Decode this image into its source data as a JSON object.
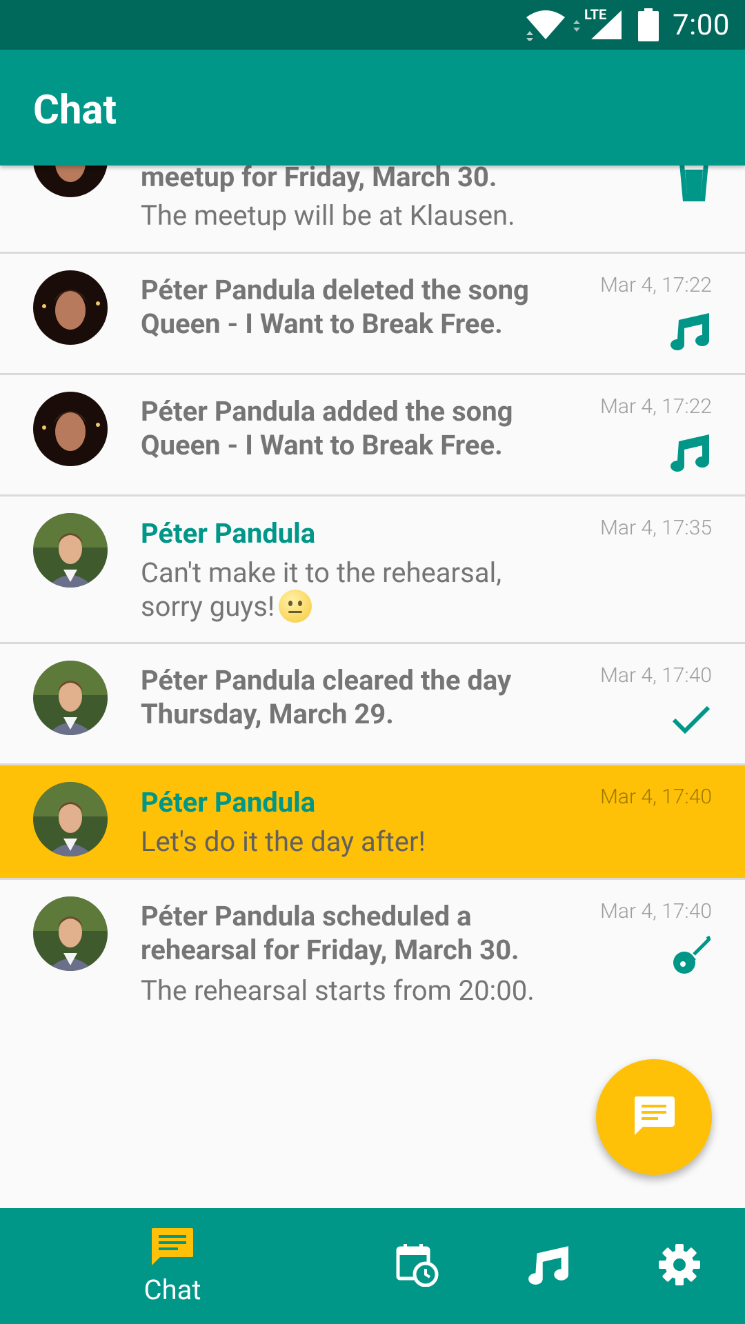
{
  "status_bar": {
    "time": "7:00",
    "network": "LTE"
  },
  "app_bar": {
    "title": "Chat"
  },
  "messages": [
    {
      "kind": "system",
      "text": "meetup for Friday, March 30.",
      "detail": "The meetup will be at Klausen.",
      "icon": "drink-icon"
    },
    {
      "kind": "system",
      "text": "Péter Pandula deleted the song Queen - I Want to Break Free.",
      "time": "Mar 4, 17:22",
      "icon": "music-note-icon"
    },
    {
      "kind": "system",
      "text": "Péter Pandula added the song Queen - I Want to Break Free.",
      "time": "Mar 4, 17:22",
      "icon": "music-note-icon"
    },
    {
      "kind": "chat",
      "sender": "Péter Pandula",
      "text": "Can't make it to the rehearsal, sorry guys!",
      "emoji": "neutral-face",
      "time": "Mar 4, 17:35"
    },
    {
      "kind": "system",
      "text": "Péter Pandula cleared the day Thursday, March 29.",
      "time": "Mar 4, 17:40",
      "icon": "check-icon"
    },
    {
      "kind": "chat",
      "sender": "Péter Pandula",
      "text": "Let's do it the day after!",
      "time": "Mar 4, 17:40",
      "highlighted": true
    },
    {
      "kind": "system",
      "text": "Péter Pandula scheduled a rehearsal for Friday, March 30.",
      "detail": "The rehearsal starts from 20:00.",
      "time": "Mar 4, 17:40",
      "icon": "guitar-icon"
    }
  ],
  "fab": {
    "icon": "message-icon"
  },
  "bottom_nav": {
    "items": [
      {
        "label": "Chat",
        "icon": "chat-icon",
        "active": true
      },
      {
        "icon": "calendar-clock-icon"
      },
      {
        "icon": "music-note-icon"
      },
      {
        "icon": "settings-icon"
      }
    ]
  },
  "colors": {
    "primary": "#009688",
    "primary_dark": "#00695C",
    "accent": "#FFC107",
    "secondary_text": "#757575"
  }
}
